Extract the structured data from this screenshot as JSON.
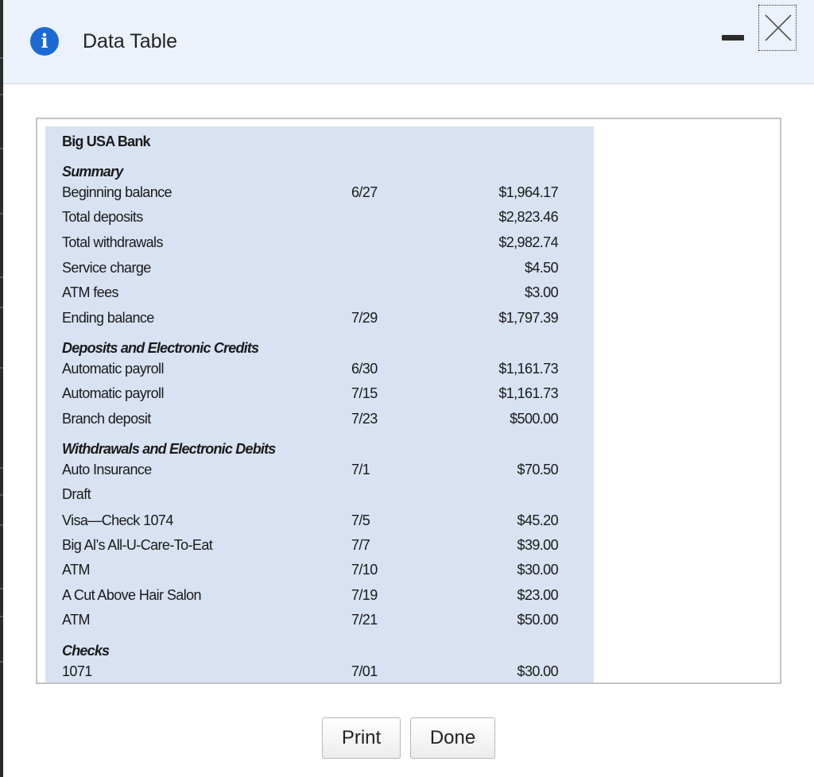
{
  "dialog": {
    "title": "Data Table",
    "icon": "info-icon",
    "controls": [
      "minimize-icon",
      "close-icon"
    ]
  },
  "statement": {
    "bank_name": "Big USA Bank",
    "summary": {
      "heading": "Summary",
      "rows": [
        {
          "label": "Beginning balance",
          "date": "6/27",
          "amount": "$1,964.17"
        },
        {
          "label": "Total deposits",
          "date": "",
          "amount": "$2,823.46"
        },
        {
          "label": "Total withdrawals",
          "date": "",
          "amount": "$2,982.74"
        },
        {
          "label": "Service charge",
          "date": "",
          "amount": "$4.50"
        },
        {
          "label": "ATM fees",
          "date": "",
          "amount": "$3.00"
        },
        {
          "label": "Ending balance",
          "date": "7/29",
          "amount": "$1,797.39"
        }
      ]
    },
    "deposits": {
      "heading": "Deposits and Electronic Credits",
      "rows": [
        {
          "label": "Automatic payroll",
          "date": "6/30",
          "amount": "$1,161.73"
        },
        {
          "label": "Automatic payroll",
          "date": "7/15",
          "amount": "$1,161.73"
        },
        {
          "label": "Branch deposit",
          "date": "7/23",
          "amount": "$500.00"
        }
      ]
    },
    "withdrawals": {
      "heading": "Withdrawals and Electronic Debits",
      "rows": [
        {
          "label": "Auto Insurance",
          "date": "7/1",
          "amount": "$70.50"
        },
        {
          "label": "Draft",
          "date": "",
          "amount": ""
        },
        {
          "label": "Visa—Check 1074",
          "date": "7/5",
          "amount": "$45.20"
        },
        {
          "label": "Big Al’s All-U-Care-To-Eat",
          "date": "7/7",
          "amount": "$39.00"
        },
        {
          "label": "ATM",
          "date": "7/10",
          "amount": "$30.00"
        },
        {
          "label": "A Cut Above Hair Salon",
          "date": "7/19",
          "amount": "$23.00"
        },
        {
          "label": "ATM",
          "date": "7/21",
          "amount": "$50.00"
        }
      ]
    },
    "checks": {
      "heading": "Checks",
      "rows": [
        {
          "label": "1071",
          "date": "7/01",
          "amount": "$30.00"
        }
      ]
    }
  },
  "buttons": {
    "print_label": "Print",
    "done_label": "Done"
  },
  "colors": {
    "header_bg": "#ebf2fb",
    "info_icon": "#1b6ad4",
    "table_bg": "#d8e2f3"
  }
}
